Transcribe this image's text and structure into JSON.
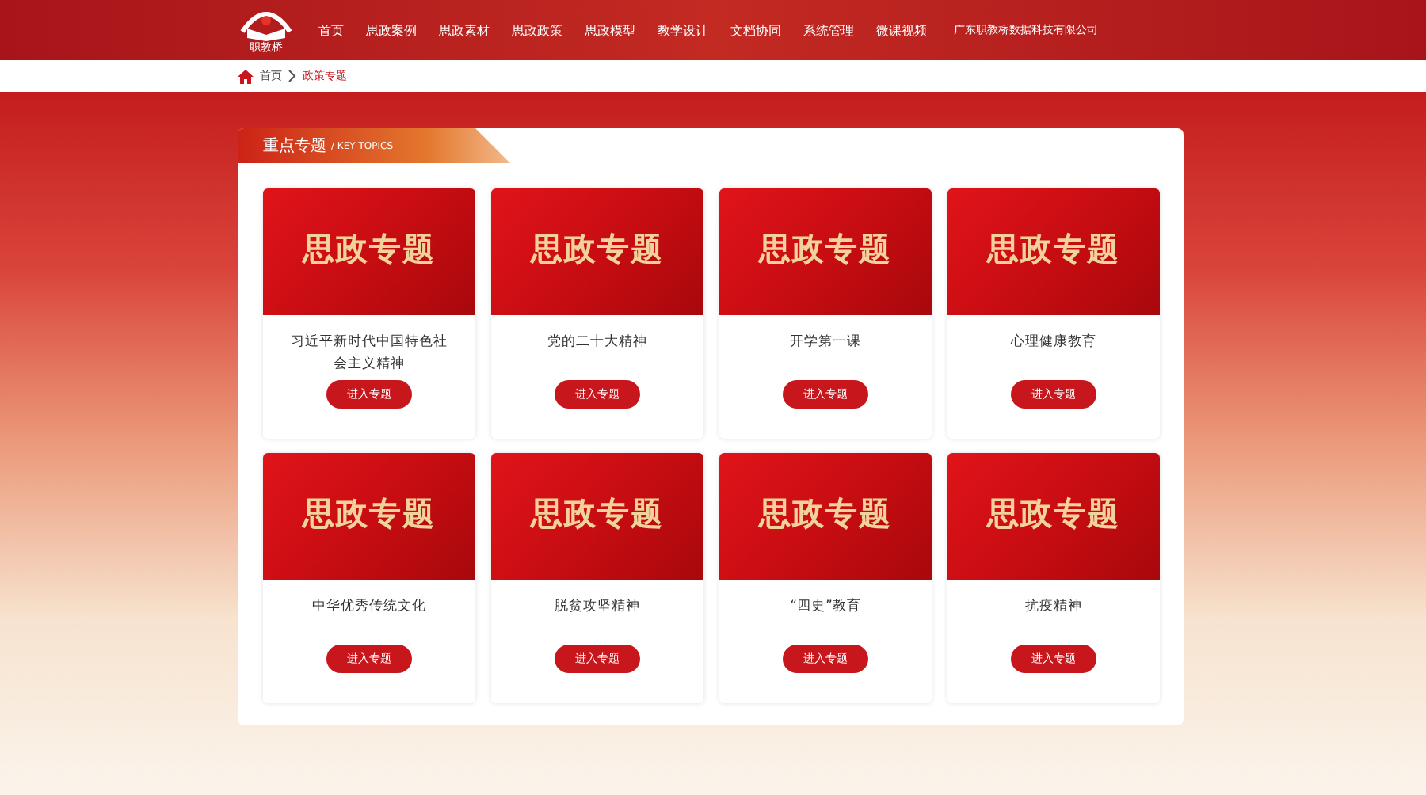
{
  "nav": {
    "logo_text": "职教桥",
    "items": [
      {
        "label": "首页",
        "selected": false
      },
      {
        "label": "思政案例",
        "selected": false
      },
      {
        "label": "思政素材",
        "selected": false
      },
      {
        "label": "思政政策",
        "selected": false
      },
      {
        "label": "思政模型",
        "selected": false
      },
      {
        "label": "教学设计",
        "selected": false
      },
      {
        "label": "文档协同",
        "selected": false
      },
      {
        "label": "系统管理",
        "selected": false
      },
      {
        "label": "微课视频",
        "selected": false
      }
    ],
    "company": "广东职教桥数据科技有限公司"
  },
  "breadcrumb": [
    "首页",
    "政策专题"
  ],
  "section": {
    "title": "重点专题",
    "subtitle": "/ KEY TOPICS"
  },
  "cards": [
    {
      "banner_title": "思政专题",
      "title": "习近平新时代中国特色社会主义精神",
      "button": "进入专题"
    },
    {
      "banner_title": "思政专题",
      "title": "党的二十大精神",
      "button": "进入专题"
    },
    {
      "banner_title": "思政专题",
      "title": "开学第一课",
      "button": "进入专题"
    },
    {
      "banner_title": "思政专题",
      "title": "心理健康教育",
      "button": "进入专题"
    },
    {
      "banner_title": "思政专题",
      "title": "中华优秀传统文化",
      "button": "进入专题"
    },
    {
      "banner_title": "思政专题",
      "title": "脱贫攻坚精神",
      "button": "进入专题"
    },
    {
      "banner_title": "思政专题",
      "title": "“四史”教育",
      "button": "进入专题"
    },
    {
      "banner_title": "思政专题",
      "title": "抗疫精神",
      "button": "进入专题"
    }
  ]
}
